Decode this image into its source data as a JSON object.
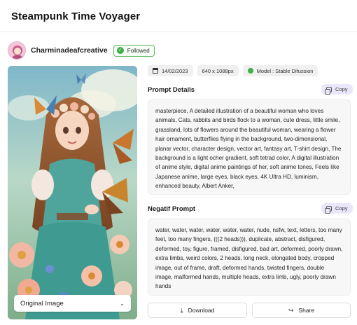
{
  "page": {
    "title": "Steampunk Time Voyager"
  },
  "creator": {
    "name": "Charminadeafcreative",
    "follow_label": "Followed"
  },
  "image": {
    "select_label": "Original Image"
  },
  "meta": {
    "date": "14/02/2023",
    "size": "640 x 1088px",
    "model": "Model : Stable Difussion"
  },
  "prompt": {
    "heading": "Prompt Details",
    "copy_label": "Copy",
    "text": "masterpiece, A detailed illustration of a beautiful woman who loves animals, Cats, rabbits and birds flock to a woman, cute dress, little smile, grassland, lots of flowers around the beautiful woman, wearing a flower hair ornament, butterflies flying in the background, two-dimensional, planar vector, character design, vector art, fantasy art, T-shirt design, The background is a light ocher gradient, soft tetrad color, A digital illustration of anime style, digital anime paintings of her, soft anime tones, Feels like Japanese anime, large eyes, black eyes, 4K Ultra HD, luminism, enhanced beauty, Albert Anker,"
  },
  "negative": {
    "heading": "Negatif Prompt",
    "copy_label": "Copy",
    "text": "water, water, water, water, water, water, nude, nsfw, text, letters, too many feet, too many fingers, (((2 heads))), duplicate, abstract, disfigured, deformed, toy, figure, framed, disfigured, bad art, deformed, poorly drawn, extra limbs, weird colors, 2 heads, long neck, elongated body, cropped image, out of frame, draft, deformed hands, twisted fingers, double image, malformed hands, multiple heads, extra limb, ugly, poorly drawn hands"
  },
  "actions": {
    "download_label": "Download",
    "share_label": "Share"
  },
  "icons": {
    "followed": "check-circle-icon",
    "date": "calendar-icon",
    "model": "model-status-icon",
    "copy": "copy-icon",
    "download": "download-icon",
    "share": "share-icon",
    "select": "chevron-down-icon"
  },
  "colors": {
    "accent_soft": "#ebe7fb",
    "followed_green": "#3dae4a"
  }
}
